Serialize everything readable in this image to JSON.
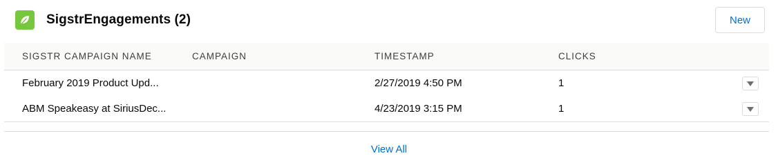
{
  "card": {
    "title": "SigstrEngagements (2)",
    "icon": "leaf-icon",
    "new_label": "New",
    "accent_color": "#76c63e",
    "link_color": "#0070d2"
  },
  "table": {
    "columns": [
      "SIGSTR CAMPAIGN NAME",
      "CAMPAIGN",
      "TIMESTAMP",
      "CLICKS"
    ],
    "rows": [
      {
        "sigstr_campaign_name": "February 2019 Product Upd...",
        "campaign": "",
        "timestamp": "2/27/2019 4:50 PM",
        "clicks": "1"
      },
      {
        "sigstr_campaign_name": "ABM Speakeasy at SiriusDec...",
        "campaign": "",
        "timestamp": "4/23/2019 3:15 PM",
        "clicks": "1"
      }
    ]
  },
  "footer": {
    "view_all_label": "View All"
  }
}
